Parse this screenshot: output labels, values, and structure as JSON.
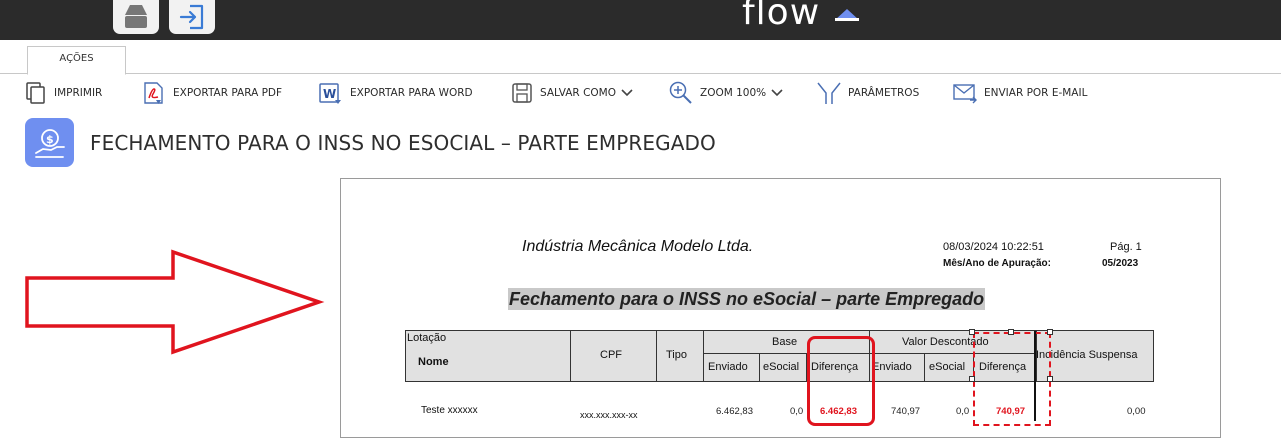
{
  "header": {
    "logo_text": "flow",
    "app_buttons": [
      "print-app-icon",
      "exit-app-icon"
    ]
  },
  "tabs": {
    "acoes": "AÇÕES"
  },
  "toolbar": {
    "imprimir": "IMPRIMIR",
    "exportar_pdf": "EXPORTAR PARA PDF",
    "exportar_word": "EXPORTAR PARA WORD",
    "salvar_como": "SALVAR COMO",
    "zoom": "ZOOM 100%",
    "parametros": "PARÂMETROS",
    "enviar_email": "ENVIAR POR E-MAIL"
  },
  "page": {
    "title": "FECHAMENTO PARA O INSS NO ESOCIAL – PARTE EMPREGADO"
  },
  "report": {
    "company": "Indústria Mecânica Modelo Ltda.",
    "datetime": "08/03/2024 10:22:51",
    "page": "Pág. 1",
    "period_label": "Mês/Ano de Apuração:",
    "period_value": "05/2023",
    "title": "Fechamento para o INSS no eSocial – parte Empregado",
    "headers": {
      "lotacao": "Lotação",
      "nome": "Nome",
      "cpf": "CPF",
      "tipo": "Tipo",
      "base": "Base",
      "valor_descontado": "Valor Descontado",
      "incidencia_suspensa": "Incidência Suspensa",
      "enviado": "Enviado",
      "esocial": "eSocial",
      "diferenca": "Diferença"
    },
    "rows": [
      {
        "nome": "Teste xxxxxx",
        "cpf": "xxx.xxx.xxx-xx",
        "base_enviado": "6.462,83",
        "base_esocial": "0,0",
        "base_diferenca": "6.462,83",
        "vd_enviado": "740,97",
        "vd_esocial": "0,0",
        "vd_diferenca": "740,97",
        "incidencia": "0,00"
      }
    ]
  },
  "colors": {
    "highlight": "#e0141e",
    "accent_icon": "#6f8ff0",
    "topbar": "#2b2b2b"
  }
}
